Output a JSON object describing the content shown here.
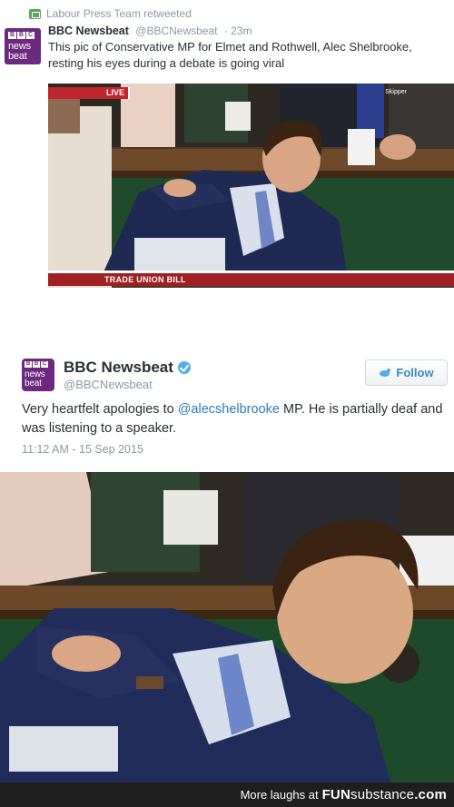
{
  "retweet": {
    "retweeted_by": "Labour Press Team retweeted",
    "author_name": "BBC Newsbeat",
    "author_handle": "@BBCNewsbeat",
    "age": "· 23m",
    "text": "This pic of Conservative MP for Elmet and Rothwell, Alec Shelbrooke, resting his eyes during a debate is going viral",
    "photo": {
      "live_label": "LIVE",
      "chyron": "TRADE UNION BILL",
      "corner_text": "Skipper"
    }
  },
  "avatar": {
    "bbc_letters": [
      "B",
      "B",
      "C"
    ],
    "line1": "news",
    "line2": "beat"
  },
  "tweet": {
    "author_name": "BBC Newsbeat",
    "author_handle": "@BBCNewsbeat",
    "follow_label": "Follow",
    "text_before": "Very heartfelt apologies to ",
    "mention": "@alecshelbrooke",
    "text_after": " MP. He is partially deaf and was listening to a speaker.",
    "timestamp": "11:12 AM - 15 Sep 2015"
  },
  "footer": {
    "prefix": "More laughs at",
    "logo_fun": "FUN",
    "logo_sub": "substance",
    "logo_tld": ".com"
  },
  "colors": {
    "bbc_purple": "#6b2a7e",
    "twitter_blue": "#55acee",
    "link_blue": "#2b7bb9",
    "live_red": "#c0272d",
    "footer_bg": "#1e1e1e"
  }
}
